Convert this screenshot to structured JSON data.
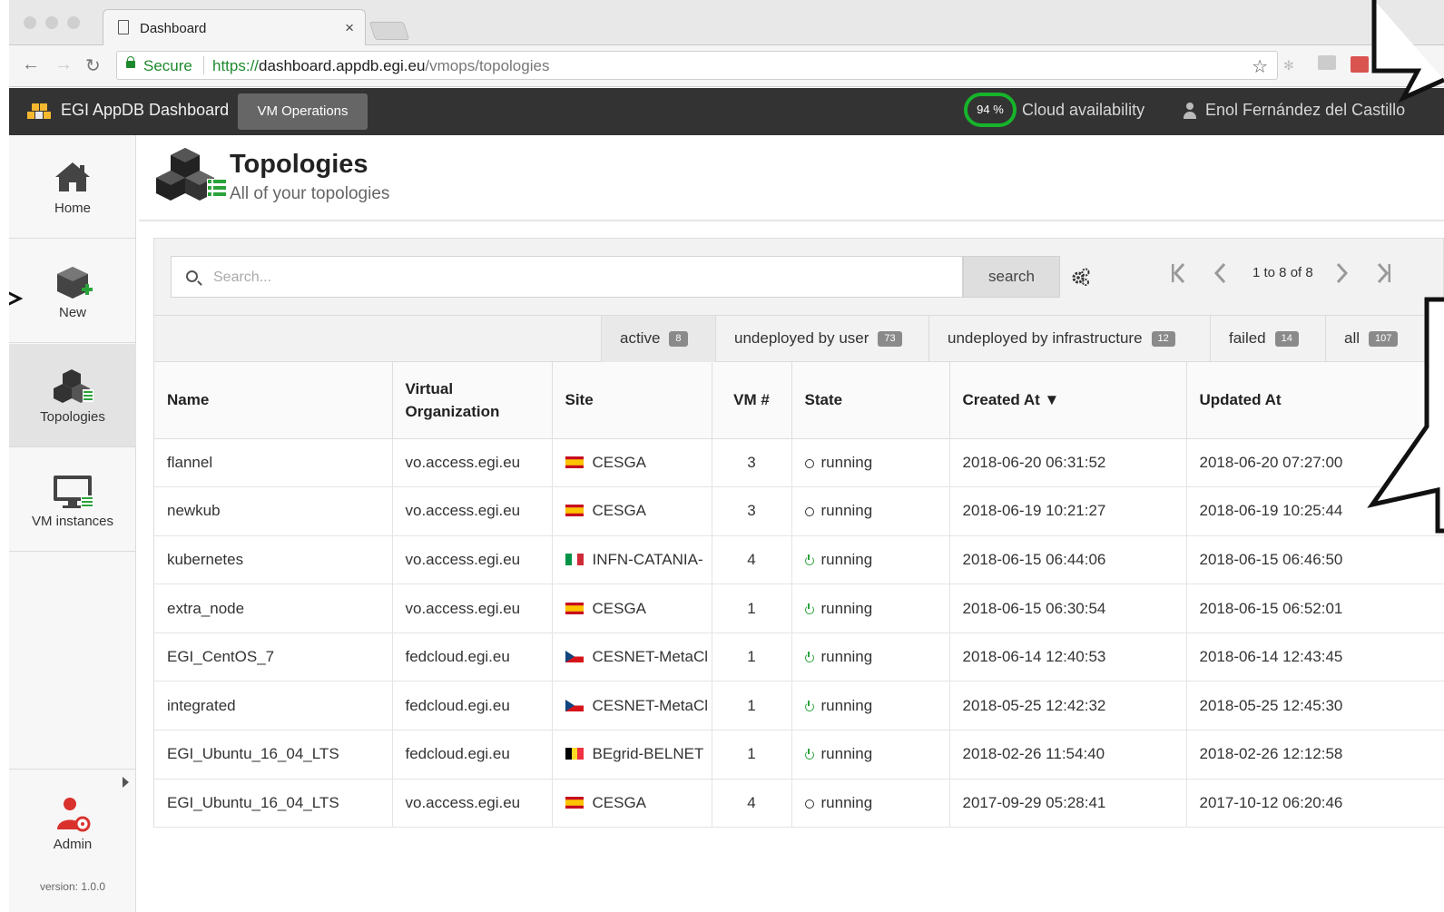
{
  "browser": {
    "tab_title": "Dashboard",
    "tab_close": "×",
    "secure_label": "Secure",
    "url_scheme": "https://",
    "url_host": "dashboard.appdb.egi.eu",
    "url_path": "/vmops/topologies",
    "nav_back": "←",
    "nav_forward": "→",
    "nav_reload": "↻",
    "star": "☆"
  },
  "header": {
    "app_title": "EGI AppDB Dashboard",
    "vm_operations": "VM Operations",
    "availability_value": "94 %",
    "availability_label": "Cloud availability",
    "user_name": "Enol Fernández del Castillo",
    "colors": {
      "bar": "#333333",
      "availability_ring": "#16b42b"
    }
  },
  "sidebar": {
    "items": [
      {
        "label": "Home",
        "icon": "home-icon"
      },
      {
        "label": "New",
        "icon": "new-vm-icon"
      },
      {
        "label": "Topologies",
        "icon": "topologies-icon",
        "active": true
      },
      {
        "label": "VM instances",
        "icon": "vm-instances-icon"
      }
    ],
    "admin_label": "Admin",
    "version": "version: 1.0.0"
  },
  "page": {
    "title": "Topologies",
    "subtitle": "All of your topologies"
  },
  "toolbar": {
    "search_placeholder": "Search...",
    "search_button": "search",
    "page_info": "1 to 8 of 8"
  },
  "filters": [
    {
      "label": "active",
      "count": "8",
      "active": true
    },
    {
      "label": "undeployed by user",
      "count": "73"
    },
    {
      "label": "undeployed by infrastructure",
      "count": "12"
    },
    {
      "label": "failed",
      "count": "14"
    },
    {
      "label": "all",
      "count": "107"
    }
  ],
  "table": {
    "columns": {
      "name": "Name",
      "vo_line1": "Virtual",
      "vo_line2": "Organization",
      "site": "Site",
      "vm": "VM #",
      "state": "State",
      "created": "Created At ▼",
      "updated": "Updated At"
    },
    "rows": [
      {
        "name": "flannel",
        "vo": "vo.access.egi.eu",
        "flag": "es",
        "site": "CESGA",
        "vm": "3",
        "state_icon": "circle",
        "state": "running",
        "created": "2018-06-20 06:31:52",
        "updated": "2018-06-20 07:27:00"
      },
      {
        "name": "newkub",
        "vo": "vo.access.egi.eu",
        "flag": "es",
        "site": "CESGA",
        "vm": "3",
        "state_icon": "circle",
        "state": "running",
        "created": "2018-06-19 10:21:27",
        "updated": "2018-06-19 10:25:44"
      },
      {
        "name": "kubernetes",
        "vo": "vo.access.egi.eu",
        "flag": "it",
        "site": "INFN-CATANIA-",
        "vm": "4",
        "state_icon": "power",
        "state": "running",
        "created": "2018-06-15 06:44:06",
        "updated": "2018-06-15 06:46:50"
      },
      {
        "name": "extra_node",
        "vo": "vo.access.egi.eu",
        "flag": "es",
        "site": "CESGA",
        "vm": "1",
        "state_icon": "power",
        "state": "running",
        "created": "2018-06-15 06:30:54",
        "updated": "2018-06-15 06:52:01"
      },
      {
        "name": "EGI_CentOS_7",
        "vo": "fedcloud.egi.eu",
        "flag": "cz",
        "site": "CESNET-MetaCl",
        "vm": "1",
        "state_icon": "power",
        "state": "running",
        "created": "2018-06-14 12:40:53",
        "updated": "2018-06-14 12:43:45"
      },
      {
        "name": "integrated",
        "vo": "fedcloud.egi.eu",
        "flag": "cz",
        "site": "CESNET-MetaCl",
        "vm": "1",
        "state_icon": "power",
        "state": "running",
        "created": "2018-05-25 12:42:32",
        "updated": "2018-05-25 12:45:30"
      },
      {
        "name": "EGI_Ubuntu_16_04_LTS",
        "vo": "fedcloud.egi.eu",
        "flag": "be",
        "site": "BEgrid-BELNET",
        "vm": "1",
        "state_icon": "power",
        "state": "running",
        "created": "2018-02-26 11:54:40",
        "updated": "2018-02-26 12:12:58"
      },
      {
        "name": "EGI_Ubuntu_16_04_LTS",
        "vo": "vo.access.egi.eu",
        "flag": "es",
        "site": "CESGA",
        "vm": "4",
        "state_icon": "circle",
        "state": "running",
        "created": "2017-09-29 05:28:41",
        "updated": "2017-10-12 06:20:46"
      }
    ]
  }
}
